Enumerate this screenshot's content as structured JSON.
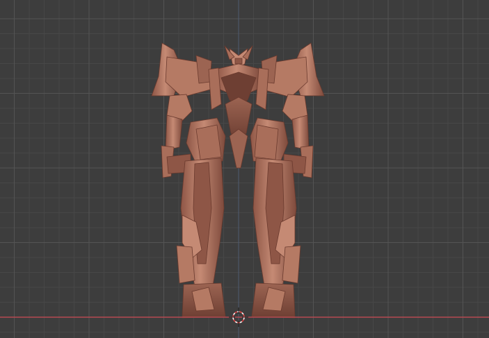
{
  "viewport": {
    "background": "#3d3d3d",
    "grid_minor_color": "#474747",
    "grid_major_color": "#545454",
    "x_axis_color": "#b54a52",
    "z_axis_color": "#4a6aa8",
    "model_color": "#b87a66",
    "model_shadow": "#7a4a3c",
    "model_highlight": "#d49a84",
    "cursor_icon": "3d-cursor-icon"
  }
}
